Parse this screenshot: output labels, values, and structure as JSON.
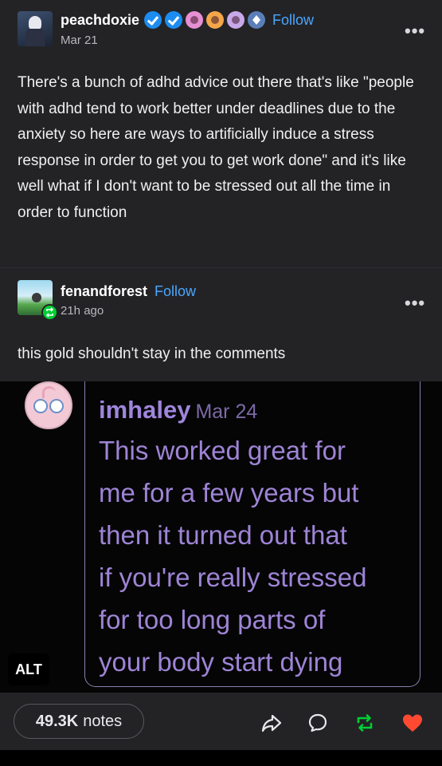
{
  "post": {
    "username": "peachdoxie",
    "follow_label": "Follow",
    "date": "Mar 21",
    "more_label": "•••",
    "body": "There's a bunch of adhd advice out there that's like \"people with adhd tend to work better under deadlines due to the anxiety so here are ways to artificially induce a stress response in order to get you to get work done\" and it's like well what if I don't want to be stressed out all the time in order to function",
    "badges": [
      "verified-check-icon",
      "verified-check-icon",
      "paw-badge-icon",
      "paw-badge-icon",
      "paw-badge-icon",
      "crystal-badge-icon"
    ]
  },
  "reblog": {
    "username": "fenandforest",
    "follow_label": "Follow",
    "time": "21h ago",
    "more_label": "•••",
    "body": "this gold shouldn't stay in the comments"
  },
  "image": {
    "comment_user": "imhaley",
    "comment_date": "Mar 24",
    "comment_lines": [
      "This worked great for",
      "me for a few years but",
      "then it turned out that",
      "if you're really stressed",
      "for too long parts of",
      "your body start dying"
    ],
    "alt_label": "ALT"
  },
  "footer": {
    "notes_count": "49.3K",
    "notes_label": "notes"
  },
  "colors": {
    "accent_follow": "#4aa6ff",
    "reblog_green": "#00cf35",
    "like_red": "#ff4930",
    "comment_purple": "#9e84d6"
  }
}
